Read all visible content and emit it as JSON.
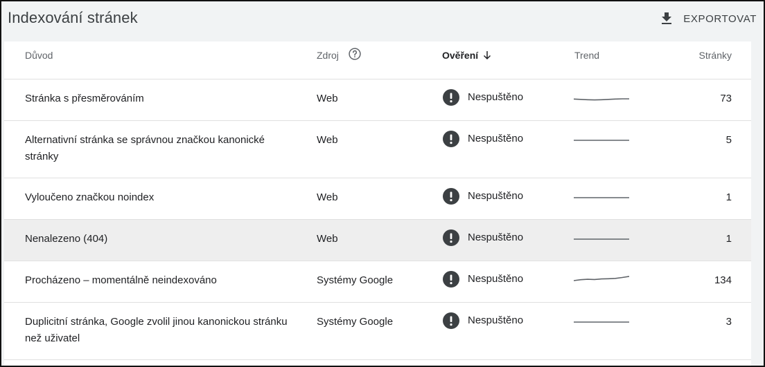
{
  "header": {
    "title": "Indexování stránek",
    "export_label": "EXPORTOVAT"
  },
  "table": {
    "columns": {
      "reason": "Důvod",
      "source": "Zdroj",
      "verification": "Ověření",
      "trend": "Trend",
      "pages": "Stránky"
    },
    "rows": [
      {
        "reason": "Stránka s přesměrováním",
        "source": "Web",
        "verification": "Nespuštěno",
        "pages": "73",
        "trend": [
          0.52,
          0.55,
          0.58,
          0.6,
          0.58,
          0.55,
          0.52,
          0.5,
          0.5
        ]
      },
      {
        "reason": "Alternativní stránka se správnou značkou kanonické stránky",
        "source": "Web",
        "verification": "Nespuštěno",
        "pages": "5",
        "trend": [
          0.5,
          0.5,
          0.5,
          0.5,
          0.5,
          0.5,
          0.5,
          0.5,
          0.5
        ]
      },
      {
        "reason": "Vyloučeno značkou noindex",
        "source": "Web",
        "verification": "Nespuštěno",
        "pages": "1",
        "trend": [
          0.5,
          0.5,
          0.5,
          0.5,
          0.5,
          0.5,
          0.5,
          0.5,
          0.5
        ]
      },
      {
        "reason": "Nenalezeno (404)",
        "source": "Web",
        "verification": "Nespuštěno",
        "pages": "1",
        "trend": [
          0.5,
          0.5,
          0.5,
          0.5,
          0.5,
          0.5,
          0.5,
          0.5,
          0.5
        ]
      },
      {
        "reason": "Procházeno – momentálně neindexováno",
        "source": "Systémy Google",
        "verification": "Nespuštěno",
        "pages": "134",
        "trend": [
          0.5,
          0.42,
          0.38,
          0.4,
          0.35,
          0.33,
          0.3,
          0.22,
          0.12
        ]
      },
      {
        "reason": "Duplicitní stránka, Google zvolil jinou kanonickou stránku než uživatel",
        "source": "Systémy Google",
        "verification": "Nespuštěno",
        "pages": "3",
        "trend": [
          0.5,
          0.5,
          0.5,
          0.5,
          0.5,
          0.5,
          0.5,
          0.5,
          0.5
        ]
      }
    ]
  },
  "colors": {
    "status_icon": "#3c4043",
    "trend_line": "#5f6368",
    "header_bg": "#f1f3f4",
    "hover_row": "#eeeeee"
  }
}
